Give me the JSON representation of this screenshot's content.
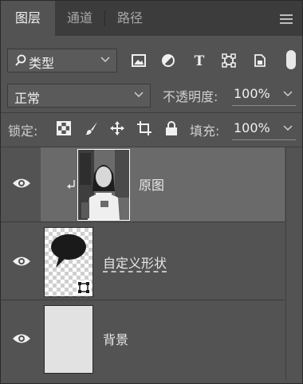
{
  "tabs": [
    {
      "label": "图层",
      "active": true
    },
    {
      "label": "通道",
      "active": false
    },
    {
      "label": "路径",
      "active": false
    }
  ],
  "filter": {
    "label": "类型",
    "icons": [
      "image-filter-icon",
      "adjustment-filter-icon",
      "type-filter-icon",
      "shape-filter-icon",
      "smart-object-filter-icon"
    ]
  },
  "blend": {
    "mode": "正常",
    "opacity_label": "不透明度:",
    "opacity_value": "100%"
  },
  "lock": {
    "label": "锁定:",
    "fill_label": "填充:",
    "fill_value": "100%"
  },
  "layers": [
    {
      "name": "原图",
      "visible": true,
      "selected": true,
      "clipped": true
    },
    {
      "name": "自定义形状",
      "visible": true,
      "selected": false
    },
    {
      "name": "背景",
      "visible": true,
      "selected": false
    }
  ],
  "colors": {
    "panel_bg": "#535353",
    "tabbar_bg": "#3c3c3c",
    "selected_row": "#6a6a6a"
  }
}
